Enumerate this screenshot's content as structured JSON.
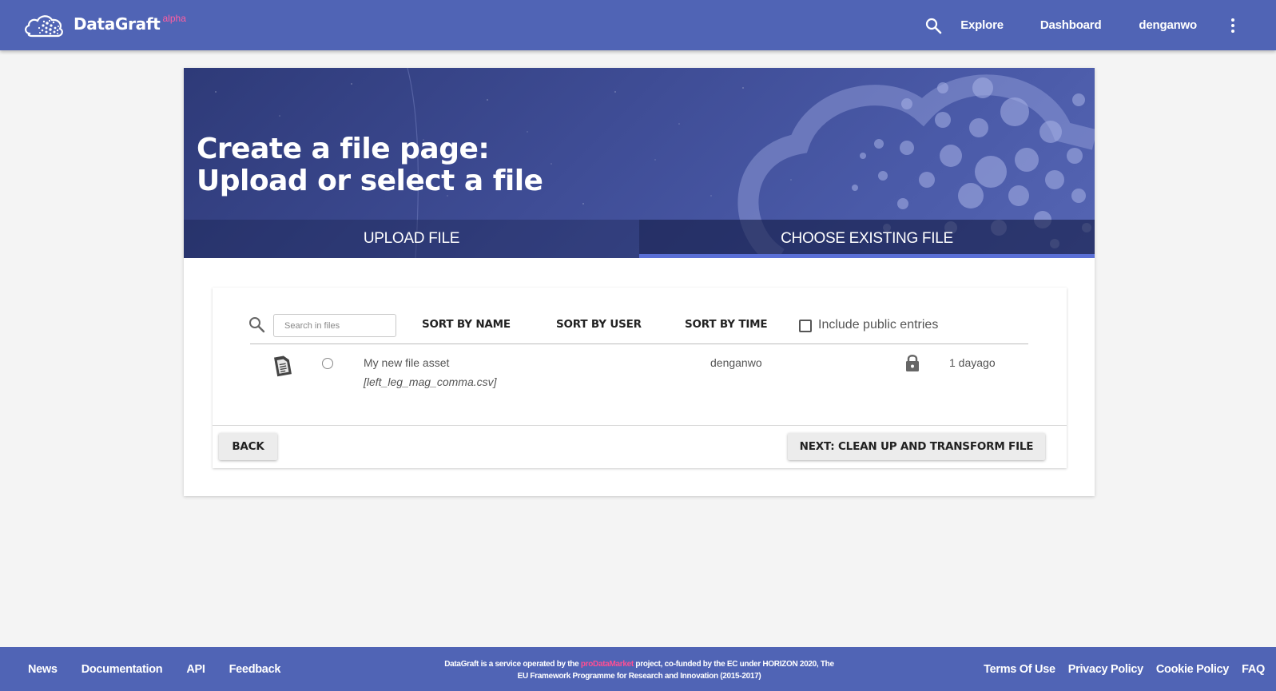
{
  "navbar": {
    "brand_name": "DataGraft",
    "brand_badge": "alpha",
    "links": [
      "Explore",
      "Dashboard",
      "denganwo"
    ],
    "icons": [
      "cloud-logo-icon",
      "search-icon",
      "more-vert-icon"
    ]
  },
  "hero": {
    "title_line1": "Create a file page:",
    "title_line2": "Upload or select a file",
    "tabs": [
      {
        "label": "UPLOAD FILE",
        "active": false
      },
      {
        "label": "CHOOSE EXISTING FILE",
        "active": true
      }
    ]
  },
  "toolbar": {
    "search_placeholder": "Search in files",
    "search_value": "",
    "sort_name": "SORT BY NAME",
    "sort_user": "SORT BY USER",
    "sort_time": "SORT BY TIME",
    "include_public_label": "Include public entries",
    "include_public_checked": false
  },
  "files": [
    {
      "title": "My new file asset",
      "filename": "[left_leg_mag_comma.csv]",
      "user": "denganwo",
      "time": "1 dayago",
      "visibility": "private",
      "selected": false
    }
  ],
  "actions": {
    "back_label": "BACK",
    "next_label": "NEXT: CLEAN UP AND TRANSFORM FILE"
  },
  "footer": {
    "left_links": [
      "News",
      "Documentation",
      "API",
      "Feedback"
    ],
    "right_links": [
      "Terms Of Use",
      "Privacy Policy",
      "Cookie Policy",
      "FAQ"
    ],
    "notice_prefix": "DataGraft is a service operated by the ",
    "notice_project": "proDataMarket",
    "notice_suffix": " project, co-funded by the EC under HORIZON 2020, The",
    "notice_line2": "EU Framework Programme for Research and Innovation (2015-2017)"
  },
  "colors": {
    "primary": "#5064b5",
    "badge": "#ff5fa2",
    "project_link": "#ff4f93",
    "tab_indicator": "#5a6fd6"
  }
}
